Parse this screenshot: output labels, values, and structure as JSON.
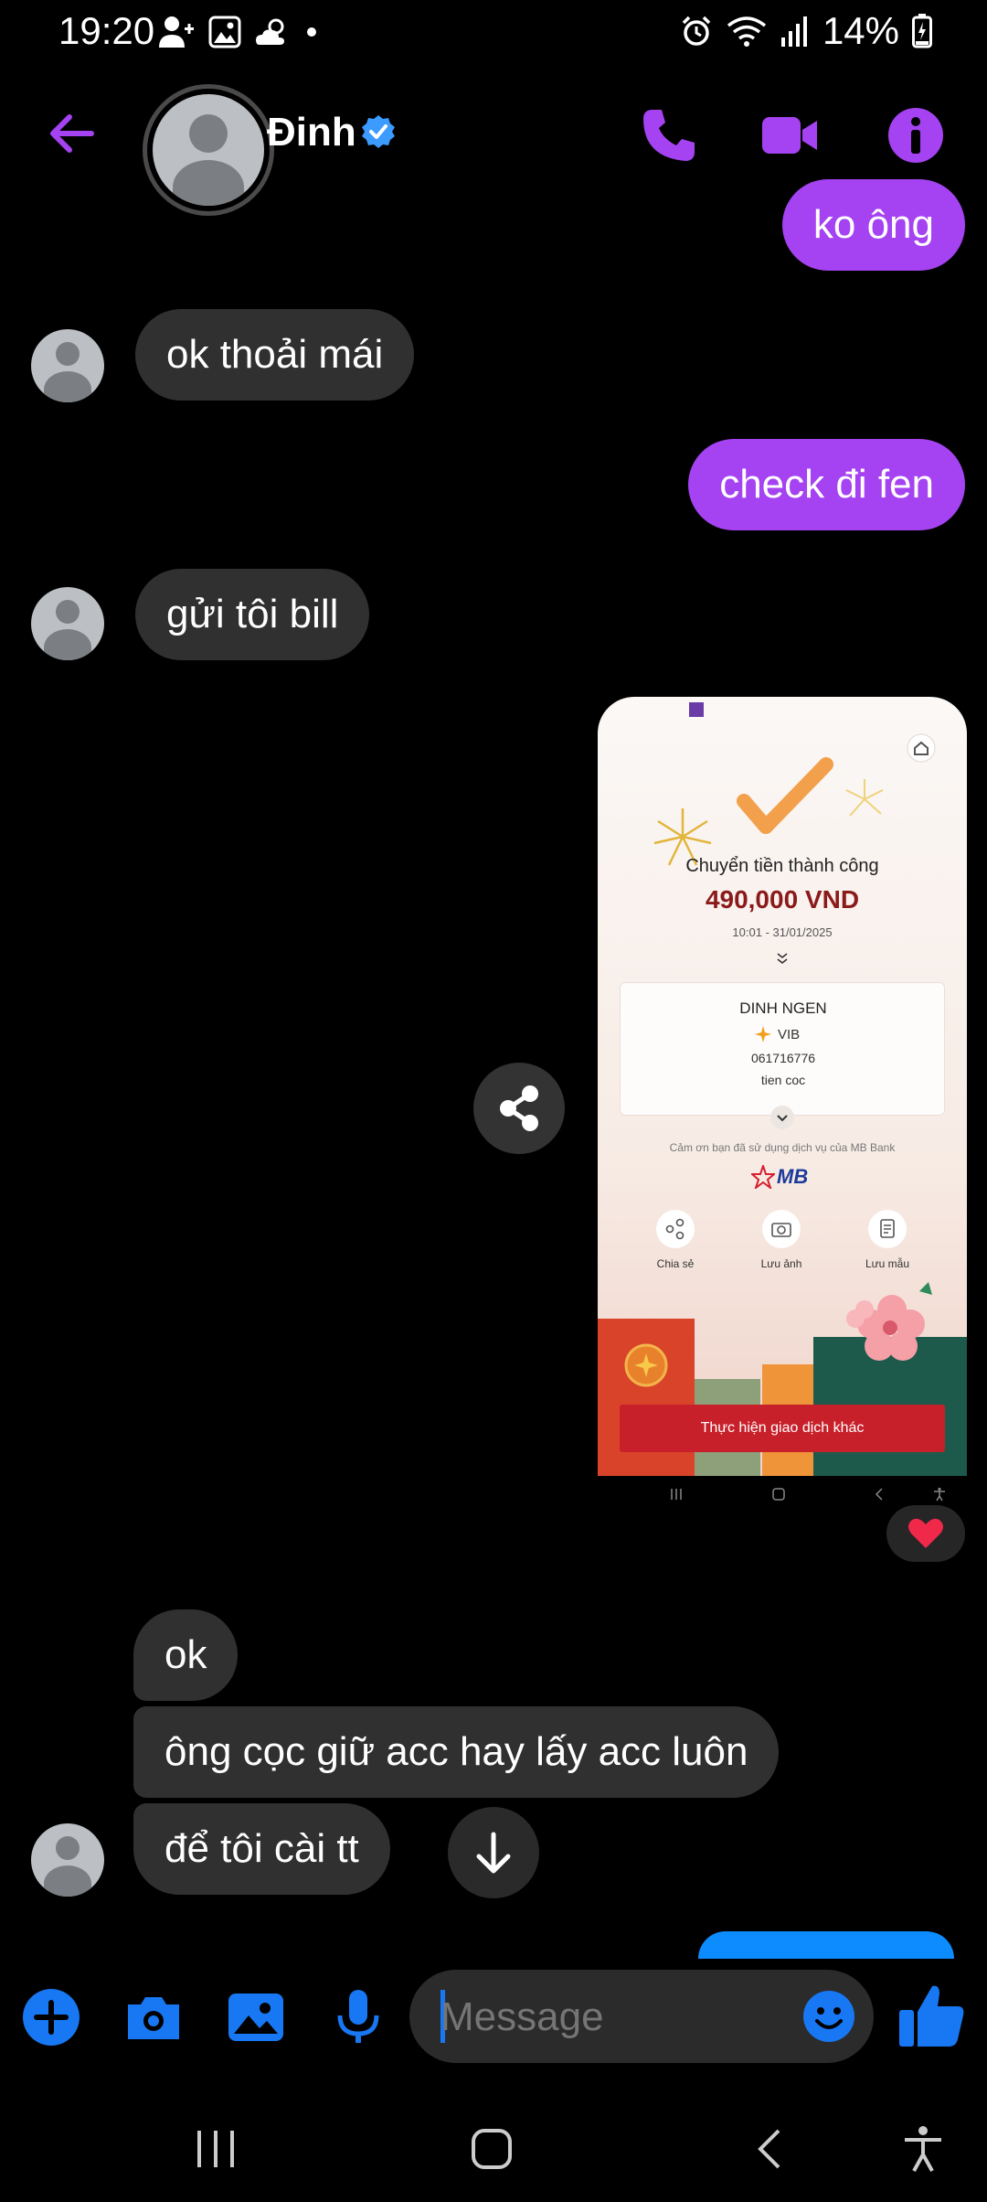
{
  "status_bar": {
    "time": "19:20",
    "battery": "14%"
  },
  "header": {
    "contact_name": "Đinh"
  },
  "messages": [
    {
      "id": "m1",
      "direction": "out",
      "text": "ko ông"
    },
    {
      "id": "m2",
      "direction": "in",
      "text": "ok thoải mái"
    },
    {
      "id": "m3",
      "direction": "out",
      "text": "check đi fen"
    },
    {
      "id": "m4",
      "direction": "in",
      "text": "gửi tôi bill"
    },
    {
      "id": "m5",
      "direction": "in",
      "text": "ok"
    },
    {
      "id": "m6",
      "direction": "in",
      "text": "ông cọc giữ acc hay lấy acc luôn"
    },
    {
      "id": "m7",
      "direction": "in",
      "text": "để tôi cài tt"
    }
  ],
  "receipt": {
    "title": "Chuyển tiền thành công",
    "amount": "490,000 VND",
    "datetime": "10:01 - 31/01/2025",
    "recipient_name": "DINH NGEN",
    "bank": "VIB",
    "account": "061716776",
    "note": "tien coc",
    "thanks": "Cảm ơn bạn đã sử dụng dịch vụ của MB Bank",
    "brand": "MB",
    "actions": [
      "Chia sẻ",
      "Lưu ảnh",
      "Lưu mẫu"
    ],
    "cta": "Thực hiện giao dịch khác"
  },
  "reaction": "heart",
  "composer": {
    "placeholder": "Message"
  },
  "colors": {
    "accent": "#a542f1",
    "incoming_bubble": "#303030",
    "messenger_blue": "#1877f2",
    "receipt_red": "#8b1a1a",
    "receipt_cta": "#c8202a"
  }
}
